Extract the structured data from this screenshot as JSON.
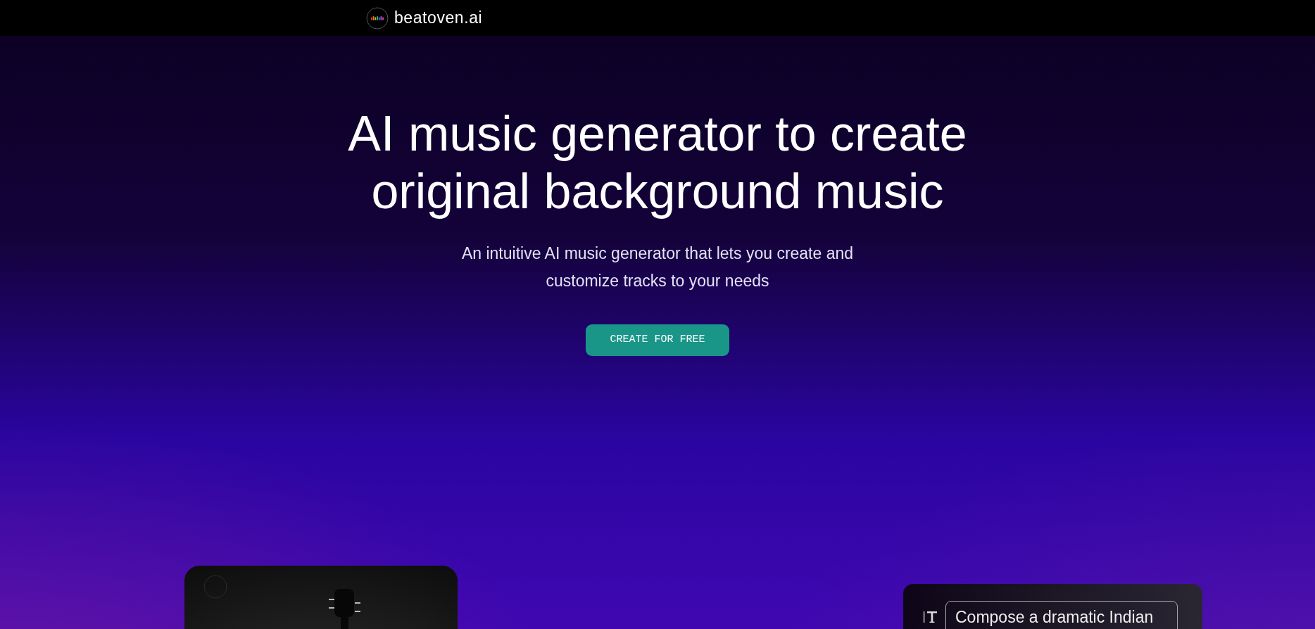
{
  "header": {
    "brand": "beatoven.ai"
  },
  "hero": {
    "title_lines": [
      "AI music generator to create",
      "original background music"
    ],
    "subtitle_lines": [
      "An intuitive AI music generator that lets you create and",
      "customize tracks to your needs"
    ],
    "cta": "CREATE FOR FREE"
  },
  "prompt_card": {
    "value": "Compose a dramatic Indian"
  }
}
